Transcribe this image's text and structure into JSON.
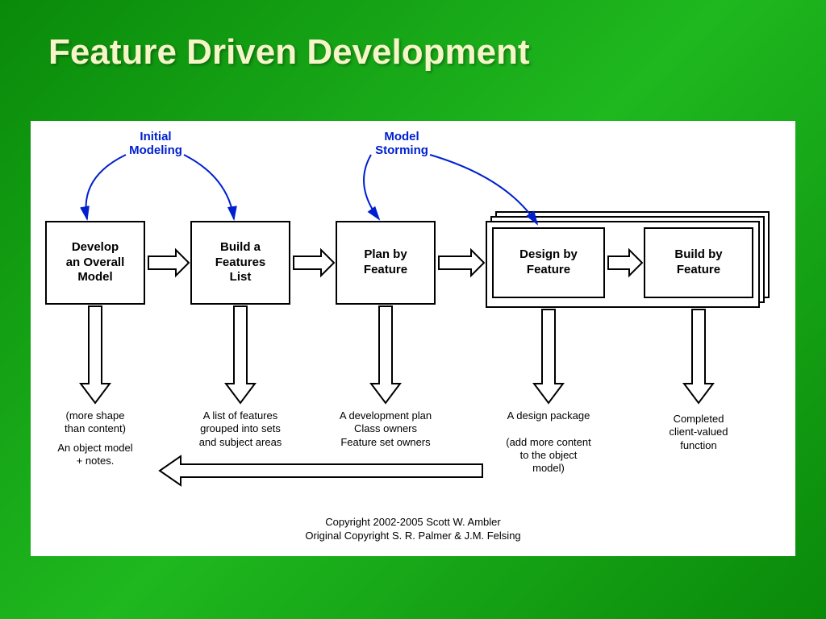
{
  "title": "Feature Driven Development",
  "annotations": {
    "initial": "Initial\nModeling",
    "storming": "Model\nStorming"
  },
  "boxes": {
    "b1": "Develop\nan Overall\nModel",
    "b2": "Build a\nFeatures\nList",
    "b3": "Plan by\nFeature",
    "b4": "Design by\nFeature",
    "b5": "Build by\nFeature"
  },
  "outputs": {
    "o1a": "(more shape\nthan content)",
    "o1b": "An object model\n+ notes.",
    "o2": "A list of features\ngrouped into sets\nand subject areas",
    "o3": "A development plan\nClass owners\nFeature set owners",
    "o4": "A design package\n\n(add more content\nto the object\nmodel)",
    "o5": "Completed\nclient-valued\nfunction"
  },
  "copyright": "Copyright 2002-2005 Scott W. Ambler\nOriginal Copyright S. R. Palmer & J.M. Felsing"
}
